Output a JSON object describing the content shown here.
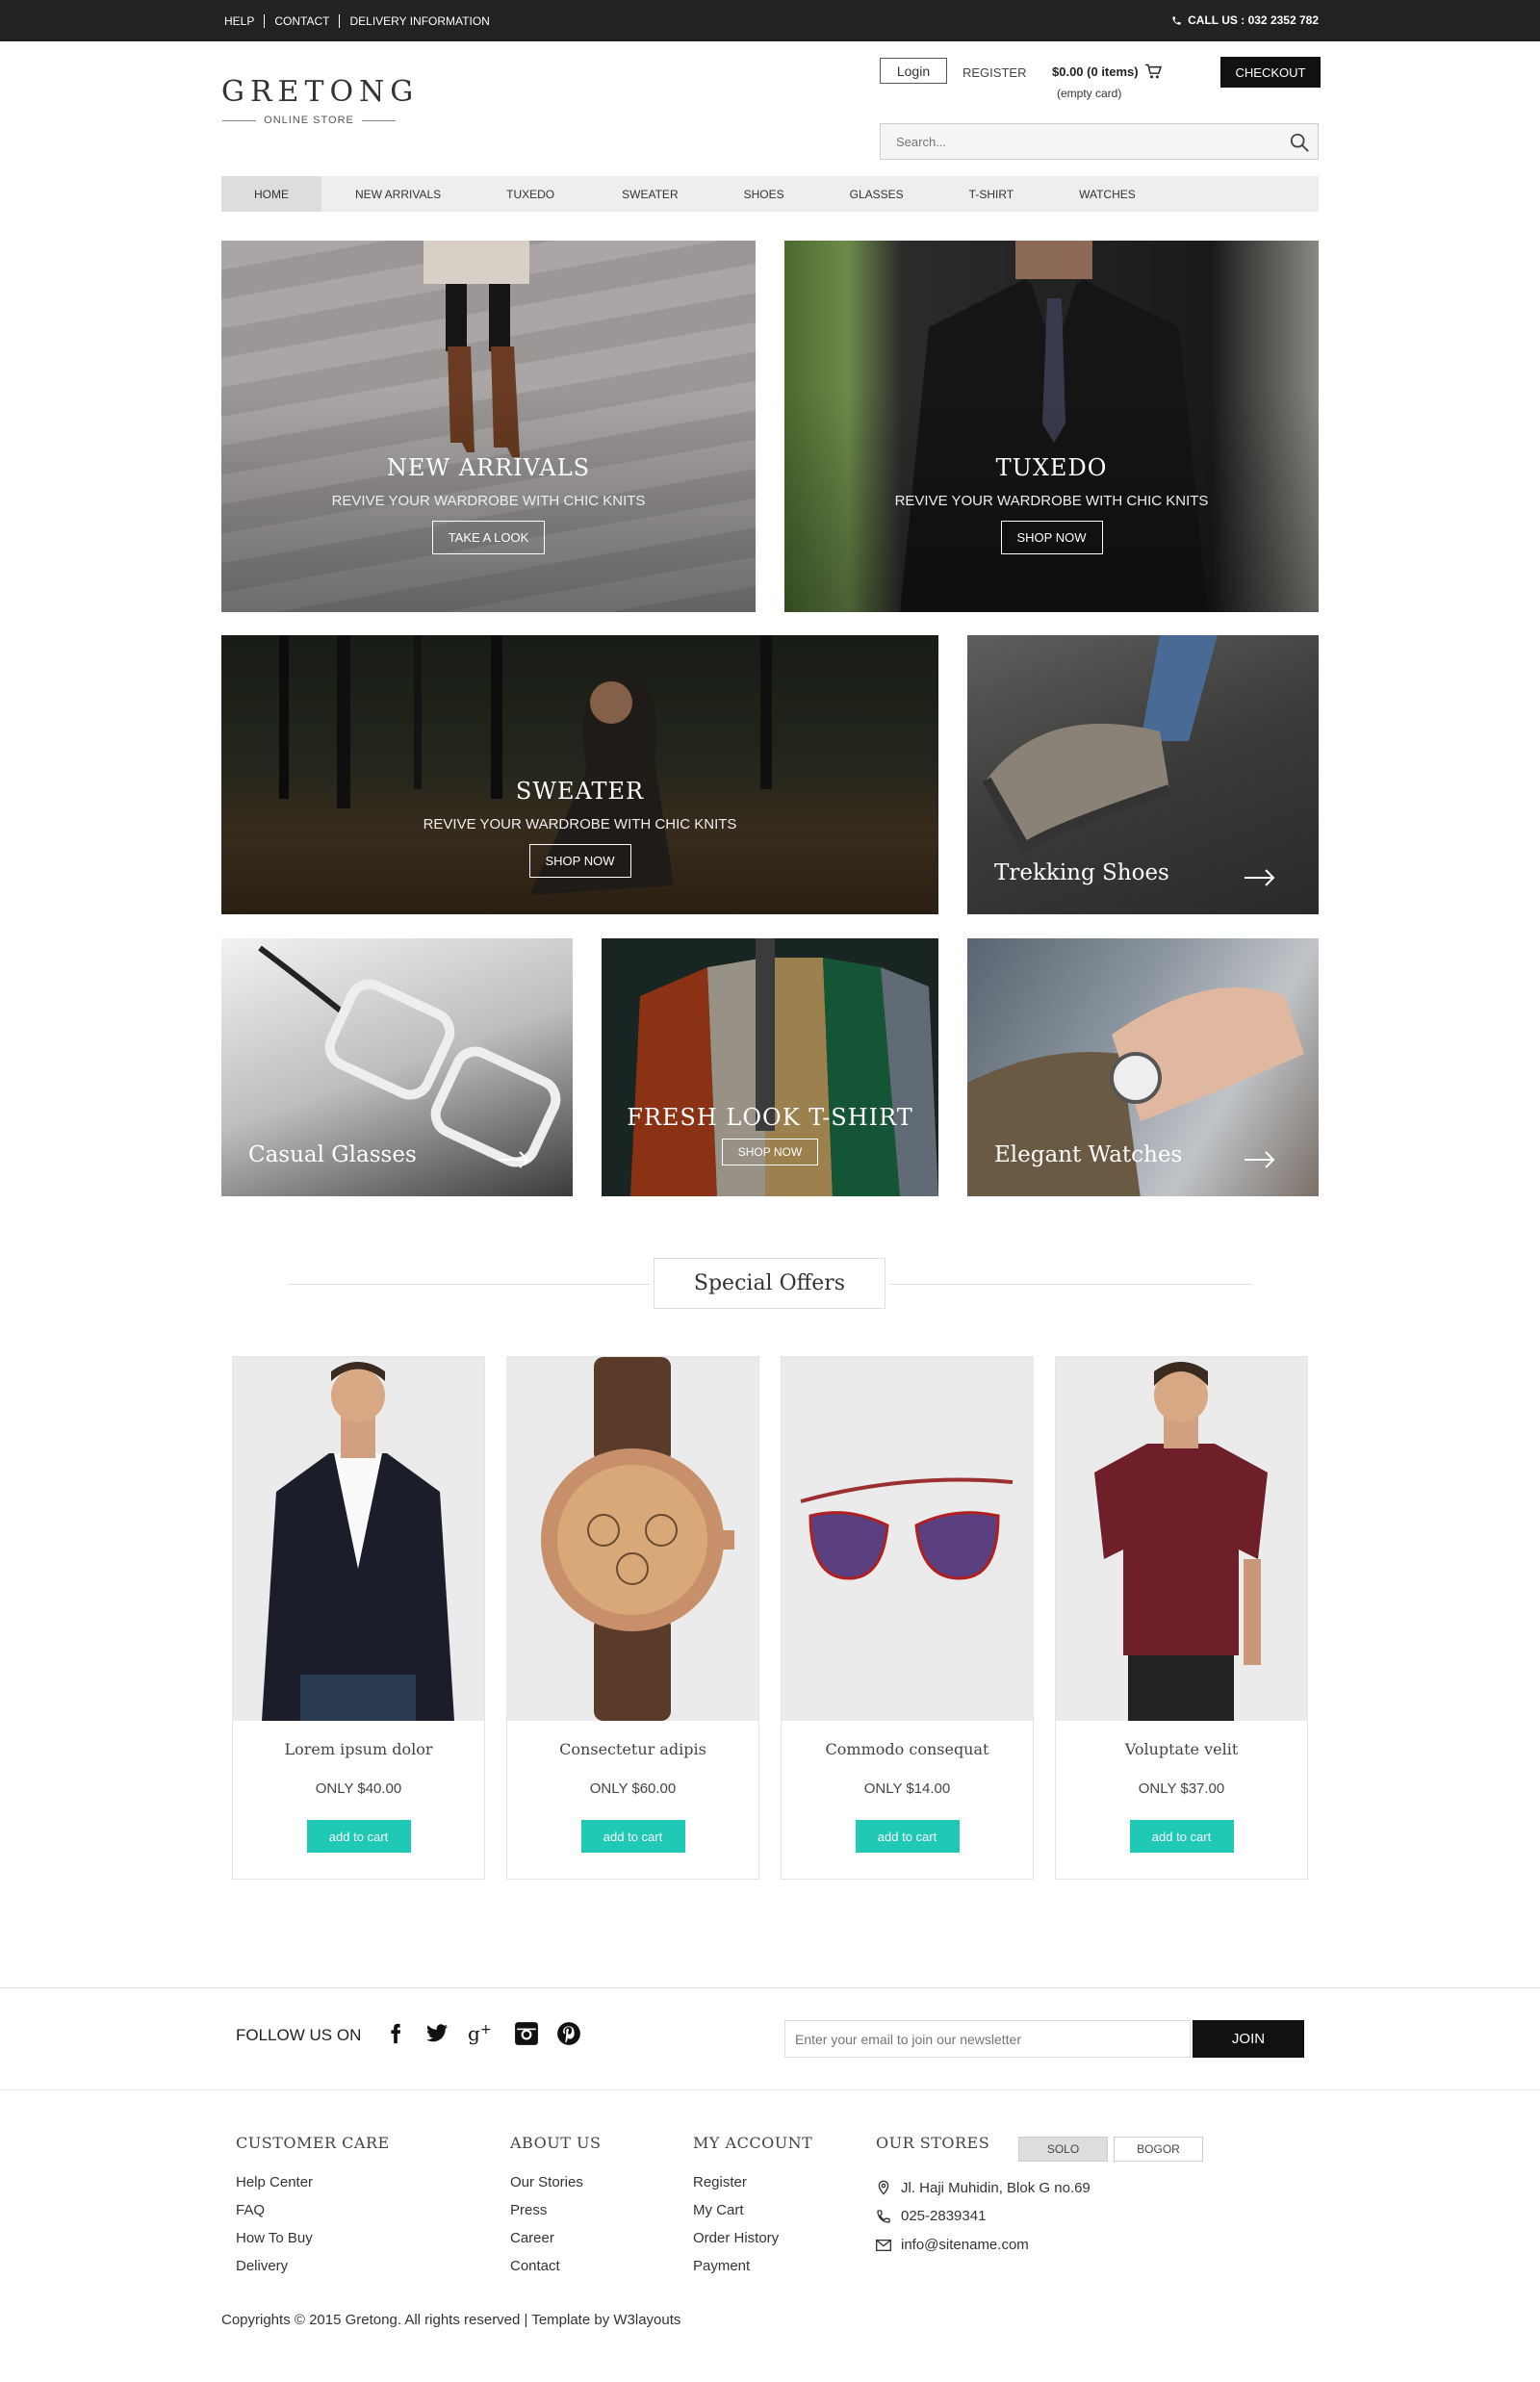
{
  "topbar": {
    "links": [
      "HELP",
      "CONTACT",
      "DELIVERY INFORMATION"
    ],
    "call": "CALL US : 032 2352 782"
  },
  "logo": {
    "name": "GRETONG",
    "tagline": "ONLINE STORE"
  },
  "header": {
    "login": "Login",
    "register": "REGISTER",
    "cart_total": "$0.00 (0 items)",
    "cart_empty": "(empty card)",
    "checkout": "CHECKOUT",
    "search_placeholder": "Search..."
  },
  "nav": [
    "HOME",
    "NEW ARRIVALS",
    "TUXEDO",
    "SWEATER",
    "SHOES",
    "GLASSES",
    "T-SHIRT",
    "WATCHES"
  ],
  "banners": {
    "new_arrivals": {
      "title": "NEW ARRIVALS",
      "subtitle": "REVIVE YOUR WARDROBE WITH CHIC KNITS",
      "button": "TAKE A LOOK"
    },
    "tuxedo": {
      "title": "TUXEDO",
      "subtitle": "REVIVE YOUR WARDROBE WITH CHIC KNITS",
      "button": "SHOP NOW"
    },
    "sweater": {
      "title": "SWEATER",
      "subtitle": "REVIVE YOUR WARDROBE WITH CHIC KNITS",
      "button": "SHOP NOW"
    },
    "trekking": {
      "caption": "Trekking Shoes"
    },
    "glasses": {
      "caption": "Casual Glasses"
    },
    "tshirt": {
      "title": "FRESH LOOK T-SHIRT",
      "button": "SHOP NOW"
    },
    "watches": {
      "caption": "Elegant Watches"
    }
  },
  "special_offers": {
    "title": "Special Offers",
    "products": [
      {
        "name": "Lorem ipsum dolor",
        "price": "ONLY $40.00",
        "button": "add to cart",
        "icon": "blazer-image"
      },
      {
        "name": "Consectetur adipis",
        "price": "ONLY $60.00",
        "button": "add to cart",
        "icon": "watch-image"
      },
      {
        "name": "Commodo consequat",
        "price": "ONLY $14.00",
        "button": "add to cart",
        "icon": "sunglasses-image"
      },
      {
        "name": "Voluptate velit",
        "price": "ONLY $37.00",
        "button": "add to cart",
        "icon": "tshirt-image"
      }
    ]
  },
  "follow": {
    "label": "FOLLOW US ON",
    "socials": [
      "facebook-icon",
      "twitter-icon",
      "google-plus-icon",
      "instagram-icon",
      "pinterest-icon"
    ],
    "newsletter_placeholder": "Enter your email to join our newsletter",
    "join": "JOIN"
  },
  "footer": {
    "customer_care": {
      "title": "CUSTOMER CARE",
      "items": [
        "Help Center",
        "FAQ",
        "How To Buy",
        "Delivery"
      ]
    },
    "about_us": {
      "title": "ABOUT US",
      "items": [
        "Our Stories",
        "Press",
        "Career",
        "Contact"
      ]
    },
    "my_account": {
      "title": "MY ACCOUNT",
      "items": [
        "Register",
        "My Cart",
        "Order History",
        "Payment"
      ]
    },
    "our_stores": {
      "title": "OUR STORES",
      "tabs": [
        "SOLO",
        "BOGOR"
      ],
      "address": "Jl. Haji Muhidin, Blok G no.69",
      "phone": "025-2839341",
      "email": "info@sitename.com"
    },
    "copyright": "Copyrights © 2015 Gretong. All rights reserved | Template by W3layouts"
  },
  "colors": {
    "accent": "#1fc9b6",
    "dark": "#222222"
  }
}
